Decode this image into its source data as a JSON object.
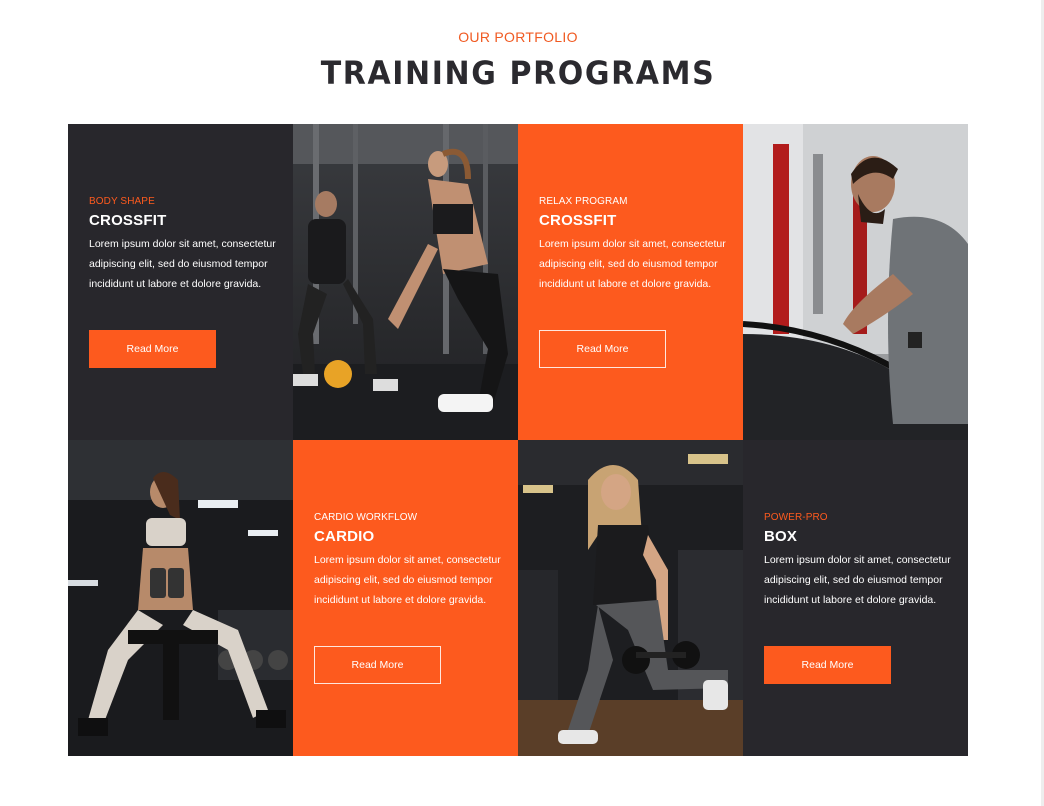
{
  "header": {
    "subtitle": "OUR PORTFOLIO",
    "title": "TRAINING PROGRAMS"
  },
  "colors": {
    "accent": "#fd5a1e",
    "dark": "#28272c",
    "white": "#ffffff"
  },
  "cards": [
    {
      "subtitle": "BODY SHAPE",
      "title": "CROSSFIT",
      "description": "Lorem ipsum dolor sit amet, consectetur adipiscing elit, sed do eiusmod tempor incididunt ut labore et dolore gravida.",
      "button": "Read More"
    },
    {
      "subtitle": "RELAX PROGRAM",
      "title": "CROSSFIT",
      "description": "Lorem ipsum dolor sit amet, consectetur adipiscing elit, sed do eiusmod tempor incididunt ut labore et dolore gravida.",
      "button": "Read More"
    },
    {
      "subtitle": "CARDIO WORKFLOW",
      "title": "CARDIO",
      "description": "Lorem ipsum dolor sit amet, consectetur adipiscing elit, sed do eiusmod tempor incididunt ut labore et dolore gravida.",
      "button": "Read More"
    },
    {
      "subtitle": "POWER-PRO",
      "title": "BOX",
      "description": "Lorem ipsum dolor sit amet, consectetur adipiscing elit, sed do eiusmod tempor incididunt ut labore et dolore gravida.",
      "button": "Read More"
    }
  ]
}
